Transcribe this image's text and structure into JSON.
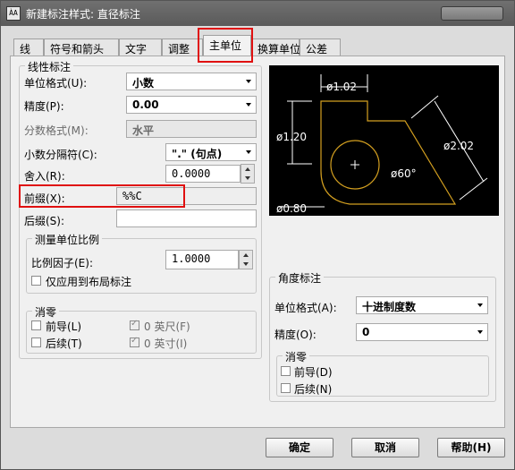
{
  "window": {
    "title": "新建标注样式: 直径标注",
    "icon_text": "ÀA"
  },
  "tabs": [
    {
      "label": "线"
    },
    {
      "label": "符号和箭头"
    },
    {
      "label": "文字"
    },
    {
      "label": "调整"
    },
    {
      "label": "主单位",
      "active": true
    },
    {
      "label": "换算单位"
    },
    {
      "label": "公差"
    }
  ],
  "linear": {
    "group_label": "线性标注",
    "unit_format_label": "单位格式(U):",
    "unit_format_value": "小数",
    "precision_label": "精度(P):",
    "precision_value": "0.00",
    "fraction_format_label": "分数格式(M):",
    "fraction_format_value": "水平",
    "decimal_sep_label": "小数分隔符(C):",
    "decimal_sep_value": "\".\" (句点)",
    "round_label": "舍入(R):",
    "round_value": "0.0000",
    "prefix_label": "前缀(X):",
    "prefix_value": "%%C",
    "suffix_label": "后缀(S):",
    "suffix_value": ""
  },
  "scale": {
    "group_label": "测量单位比例",
    "factor_label": "比例因子(E):",
    "factor_value": "1.0000",
    "layout_only_label": "仅应用到布局标注"
  },
  "zero_left": {
    "group_label": "消零",
    "leading_label": "前导(L)",
    "trailing_label": "后续(T)",
    "feet_label": "0 英尺(F)",
    "inches_label": "0 英寸(I)"
  },
  "preview": {
    "dim_top": "ø1.02",
    "dim_left": "ø1.20",
    "dim_right": "ø2.02",
    "dim_angle": "ø60°",
    "dim_bottom": "ø0.80"
  },
  "angular": {
    "group_label": "角度标注",
    "unit_format_label": "单位格式(A):",
    "unit_format_value": "十进制度数",
    "precision_label": "精度(O):",
    "precision_value": "0",
    "zero_group_label": "消零",
    "leading_label": "前导(D)",
    "trailing_label": "后续(N)"
  },
  "buttons": {
    "ok": "确定",
    "cancel": "取消",
    "help": "帮助(H)"
  },
  "colors": {
    "highlight": "#e01010",
    "preview_line": "#d4a020",
    "preview_bg": "#000000"
  }
}
